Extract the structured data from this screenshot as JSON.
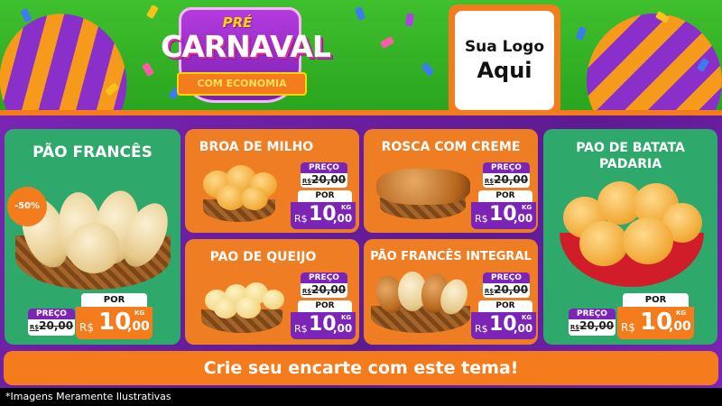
{
  "header": {
    "carnival_pre": "PRÉ",
    "carnival_title": "CARNAVAL",
    "carnival_sub": "COM ECONOMIA",
    "logo_line1": "Sua Logo",
    "logo_line2": "Aqui"
  },
  "colors": {
    "header_green": "#3fc02e",
    "body_purple": "#7b24b5",
    "accent_orange": "#f47c1c",
    "card_green": "#2ea86b",
    "card_orange": "#ef7d24"
  },
  "products": [
    {
      "name": "PÃO FRANCÊS",
      "badge": "-50%",
      "old_label": "PREÇO",
      "old_currency": "R$",
      "old_price": "20,00",
      "new_label": "POR",
      "new_currency": "R$",
      "new_int": "10",
      "new_dec": ",00",
      "unit": "KG"
    },
    {
      "name": "BROA DE MILHO",
      "old_label": "PREÇO",
      "old_currency": "R$",
      "old_price": "20,00",
      "new_label": "POR",
      "new_currency": "R$",
      "new_int": "10",
      "new_dec": ",00",
      "unit": "KG"
    },
    {
      "name": "ROSCA COM CREME",
      "old_label": "PREÇO",
      "old_currency": "R$",
      "old_price": "20,00",
      "new_label": "POR",
      "new_currency": "R$",
      "new_int": "10",
      "new_dec": ",00",
      "unit": "KG"
    },
    {
      "name_line1": "PAO DE BATATA",
      "name_line2": "PADARIA",
      "old_label": "PREÇO",
      "old_currency": "R$",
      "old_price": "20,00",
      "new_label": "POR",
      "new_currency": "R$",
      "new_int": "10",
      "new_dec": ",00",
      "unit": "KG"
    },
    {
      "name": "PAO DE QUEIJO",
      "old_label": "PREÇO",
      "old_currency": "R$",
      "old_price": "20,00",
      "new_label": "POR",
      "new_currency": "R$",
      "new_int": "10",
      "new_dec": ",00",
      "unit": "KG"
    },
    {
      "name": "PÃO FRANCÊS INTEGRAL",
      "old_label": "PREÇO",
      "old_currency": "R$",
      "old_price": "20,00",
      "new_label": "POR",
      "new_currency": "R$",
      "new_int": "10",
      "new_dec": ",00",
      "unit": "KG"
    }
  ],
  "cta": "Crie seu encarte com este tema!",
  "footer": "*Imagens Meramente Ilustrativas"
}
